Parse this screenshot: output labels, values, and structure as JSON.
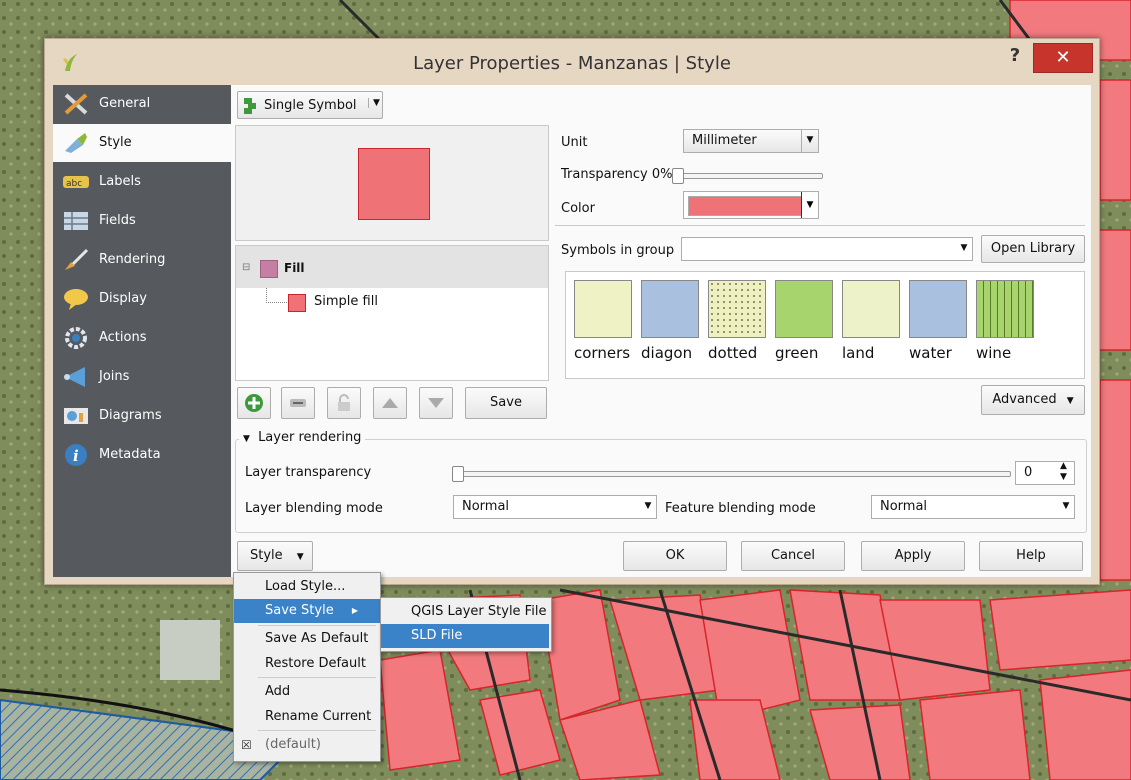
{
  "dialog": {
    "title": "Layer Properties - Manzanas | Style",
    "help_label": "?",
    "close_label": "✕"
  },
  "sidebar": {
    "items": [
      {
        "label": "General",
        "icon": "tools-icon"
      },
      {
        "label": "Style",
        "icon": "paintbrush-icon"
      },
      {
        "label": "Labels",
        "icon": "abc-icon"
      },
      {
        "label": "Fields",
        "icon": "table-icon"
      },
      {
        "label": "Rendering",
        "icon": "brush-icon"
      },
      {
        "label": "Display",
        "icon": "speech-bubble-icon"
      },
      {
        "label": "Actions",
        "icon": "gear-icon"
      },
      {
        "label": "Joins",
        "icon": "join-icon"
      },
      {
        "label": "Diagrams",
        "icon": "diagram-icon"
      },
      {
        "label": "Metadata",
        "icon": "info-icon"
      }
    ]
  },
  "renderer": {
    "value": "Single Symbol"
  },
  "symbol_tree": {
    "root": "Fill",
    "child": "Simple fill"
  },
  "symbol_props": {
    "unit_label": "Unit",
    "unit_value": "Millimeter",
    "transparency_label": "Transparency 0%",
    "color_label": "Color",
    "fill_color": "#ef7376"
  },
  "library": {
    "group_label": "Symbols in group",
    "group_value": "",
    "open_library": "Open Library",
    "symbols": [
      {
        "name": "corners",
        "color": "#eef2c4"
      },
      {
        "name": "diagonal",
        "color": "#a9c0de"
      },
      {
        "name": "dotted",
        "color": "#eef0c0"
      },
      {
        "name": "green",
        "color": "#a7d46c"
      },
      {
        "name": "land",
        "color": "#eef2c8"
      },
      {
        "name": "water",
        "color": "#a9c0de"
      },
      {
        "name": "wine",
        "color": "#a7d46c"
      }
    ],
    "symbol_labels_visible": [
      "corners",
      "diagon",
      "dotted",
      "green",
      "land",
      "water",
      "wine"
    ]
  },
  "toolbar": {
    "save_label": "Save",
    "advanced_label": "Advanced"
  },
  "layer_rendering": {
    "section_title": "Layer rendering",
    "transparency_label": "Layer transparency",
    "transparency_value": "0",
    "blending_label": "Layer blending mode",
    "blending_value": "Normal",
    "feature_blending_label": "Feature blending mode",
    "feature_blending_value": "Normal"
  },
  "footer": {
    "style_label": "Style",
    "ok_label": "OK",
    "cancel_label": "Cancel",
    "apply_label": "Apply",
    "help_label": "Help"
  },
  "style_menu": {
    "items": [
      "Load Style...",
      "Save Style",
      "Save As Default",
      "Restore Default",
      "Add",
      "Rename Current",
      "(default)"
    ]
  },
  "save_submenu": {
    "items": [
      "QGIS Layer Style File",
      "SLD File"
    ]
  }
}
